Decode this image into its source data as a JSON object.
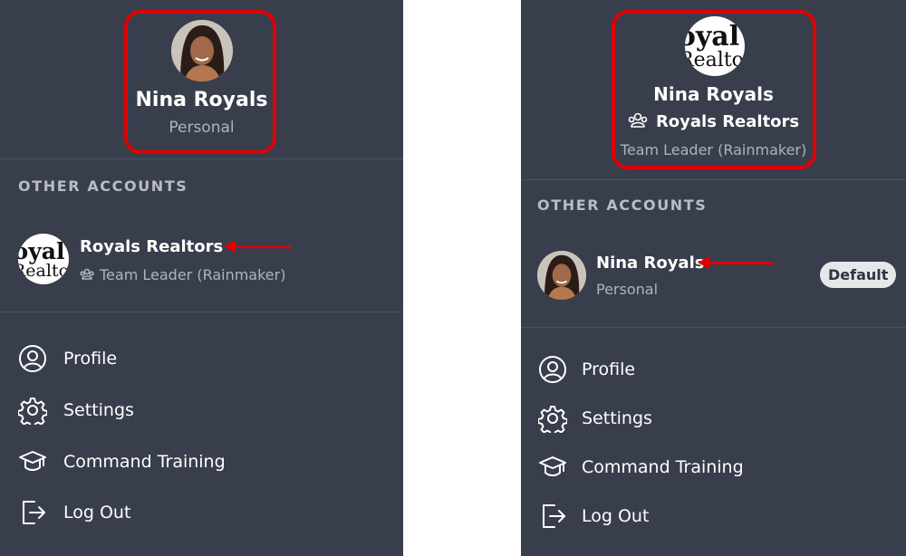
{
  "left_panel": {
    "current_account": {
      "name": "Nina Royals",
      "type": "Personal",
      "avatar": "woman-portrait-photo"
    },
    "other_accounts_heading": "OTHER ACCOUNTS",
    "other_accounts": [
      {
        "name": "Royals Realtors",
        "role": "Team Leader (Rainmaker)",
        "role_icon": "team-icon",
        "logo_line1": "oyal",
        "logo_line2": "Realto"
      }
    ],
    "menu": [
      {
        "label": "Profile",
        "icon": "user-circle-icon"
      },
      {
        "label": "Settings",
        "icon": "gear-icon"
      },
      {
        "label": "Command Training",
        "icon": "graduation-cap-icon"
      },
      {
        "label": "Log Out",
        "icon": "logout-icon"
      }
    ]
  },
  "right_panel": {
    "current_account": {
      "name": "Nina Royals",
      "team": "Royals Realtors",
      "team_icon": "team-icon",
      "role": "Team Leader (Rainmaker)",
      "logo_line1": "oyal",
      "logo_line2": "Realto"
    },
    "other_accounts_heading": "OTHER ACCOUNTS",
    "other_accounts": [
      {
        "name": "Nina Royals",
        "type": "Personal",
        "badge": "Default",
        "avatar": "woman-portrait-photo"
      }
    ],
    "menu": [
      {
        "label": "Profile",
        "icon": "user-circle-icon"
      },
      {
        "label": "Settings",
        "icon": "gear-icon"
      },
      {
        "label": "Command Training",
        "icon": "graduation-cap-icon"
      },
      {
        "label": "Log Out",
        "icon": "logout-icon"
      }
    ]
  },
  "colors": {
    "panel_bg": "#393e4d",
    "annotation_red": "#e00000",
    "muted_text": "#aeb3c1",
    "badge_bg": "#e6e7ea"
  }
}
